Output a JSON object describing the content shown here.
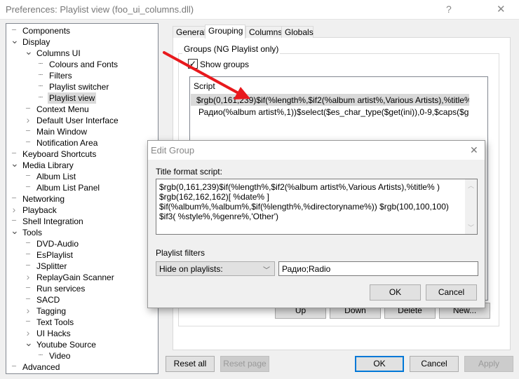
{
  "window": {
    "title": "Preferences: Playlist view (foo_ui_columns.dll)",
    "help": "?",
    "close": "✕"
  },
  "tree": [
    {
      "label": "Components",
      "level": 0,
      "exp": ""
    },
    {
      "label": "Display",
      "level": 0,
      "exp": "v"
    },
    {
      "label": "Columns UI",
      "level": 1,
      "exp": "v"
    },
    {
      "label": "Colours and Fonts",
      "level": 2,
      "exp": ""
    },
    {
      "label": "Filters",
      "level": 2,
      "exp": ""
    },
    {
      "label": "Playlist switcher",
      "level": 2,
      "exp": ""
    },
    {
      "label": "Playlist view",
      "level": 2,
      "exp": "",
      "selected": true
    },
    {
      "label": "Context Menu",
      "level": 1,
      "exp": ""
    },
    {
      "label": "Default User Interface",
      "level": 1,
      "exp": ">"
    },
    {
      "label": "Main Window",
      "level": 1,
      "exp": ""
    },
    {
      "label": "Notification Area",
      "level": 1,
      "exp": ""
    },
    {
      "label": "Keyboard Shortcuts",
      "level": 0,
      "exp": ""
    },
    {
      "label": "Media Library",
      "level": 0,
      "exp": "v"
    },
    {
      "label": "Album List",
      "level": 1,
      "exp": ""
    },
    {
      "label": "Album List Panel",
      "level": 1,
      "exp": ""
    },
    {
      "label": "Networking",
      "level": 0,
      "exp": ""
    },
    {
      "label": "Playback",
      "level": 0,
      "exp": ">"
    },
    {
      "label": "Shell Integration",
      "level": 0,
      "exp": ""
    },
    {
      "label": "Tools",
      "level": 0,
      "exp": "v"
    },
    {
      "label": "DVD-Audio",
      "level": 1,
      "exp": ""
    },
    {
      "label": "EsPlaylist",
      "level": 1,
      "exp": ""
    },
    {
      "label": "JSplitter",
      "level": 1,
      "exp": ""
    },
    {
      "label": "ReplayGain Scanner",
      "level": 1,
      "exp": ">"
    },
    {
      "label": "Run services",
      "level": 1,
      "exp": ""
    },
    {
      "label": "SACD",
      "level": 1,
      "exp": ""
    },
    {
      "label": "Tagging",
      "level": 1,
      "exp": ">"
    },
    {
      "label": "Text Tools",
      "level": 1,
      "exp": ""
    },
    {
      "label": "UI Hacks",
      "level": 1,
      "exp": ">"
    },
    {
      "label": "Youtube Source",
      "level": 1,
      "exp": "v"
    },
    {
      "label": "Video",
      "level": 2,
      "exp": ""
    },
    {
      "label": "Advanced",
      "level": 0,
      "exp": ""
    }
  ],
  "tabs": [
    "General",
    "Grouping",
    "Columns",
    "Globals"
  ],
  "grouping": {
    "group_label": "Groups (NG Playlist only)",
    "show_groups": "Show groups",
    "list_header": "Script",
    "rows": [
      "$rgb(0,161,239)$if(%length%,$if2(%album artist%,Various Artists),%title%...",
      "Радио(%album artist%,1))$select($es_char_type($get(ini)),0-9,$caps($get(..."
    ],
    "buttons": [
      "Up",
      "Down",
      "Delete",
      "New..."
    ]
  },
  "footer": {
    "reset_all": "Reset all",
    "reset_page": "Reset page",
    "ok": "OK",
    "cancel": "Cancel",
    "apply": "Apply"
  },
  "dialog": {
    "title": "Edit Group",
    "script_label": "Title format script:",
    "script": " $rgb(0,161,239)$if(%length%,$if2(%album artist%,Various Artists),%title% ) $rgb(162,162,162)[ %date% ] $if(%album%,%album%,$if(%length%,%directoryname%)) $rgb(100,100,100) $if3( %style%,%genre%,'Other')",
    "filters_label": "Playlist filters",
    "filter_mode": "Hide on playlists:",
    "filter_value": "Радио;Radio",
    "ok": "OK",
    "cancel": "Cancel"
  },
  "colors": {
    "arrow": "#e8191d",
    "focus": "#0078d7"
  }
}
